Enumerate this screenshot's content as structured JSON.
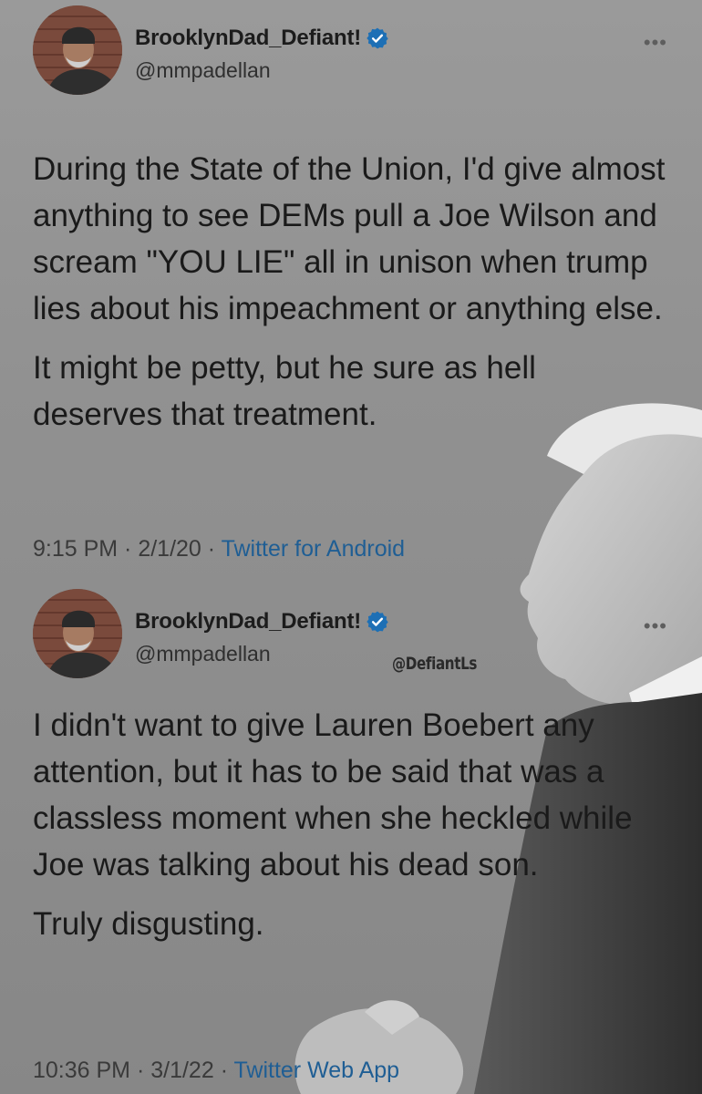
{
  "tweets": [
    {
      "display_name": "BrooklynDad_Defiant!",
      "handle": "@mmpadellan",
      "paragraphs": [
        "During the State of the Union, I'd give almost anything to see DEMs pull a Joe Wilson and scream \"YOU LIE\" all in unison when trump lies about his impeachment or anything else.",
        "It might be petty, but he sure as hell deserves that treatment."
      ],
      "time": "9:15 PM",
      "date": "2/1/20",
      "source": "Twitter for Android",
      "more": "•••"
    },
    {
      "display_name": "BrooklynDad_Defiant!",
      "handle": "@mmpadellan",
      "paragraphs": [
        "I didn't want to give Lauren Boebert any attention, but it has to be said that was a classless moment when she heckled while Joe was talking about his dead son.",
        "Truly disgusting."
      ],
      "time": "10:36 PM",
      "date": "3/1/22",
      "source": "Twitter Web App",
      "more": "•••"
    }
  ],
  "separator": " · ",
  "watermark": "@DefiantLs",
  "colors": {
    "background": "#8e8e8e",
    "source_link": "#1f5e94",
    "verified_badge": "#1d6fb5"
  },
  "icons": {
    "verified": "verified-badge-icon",
    "more": "more-options-icon"
  }
}
